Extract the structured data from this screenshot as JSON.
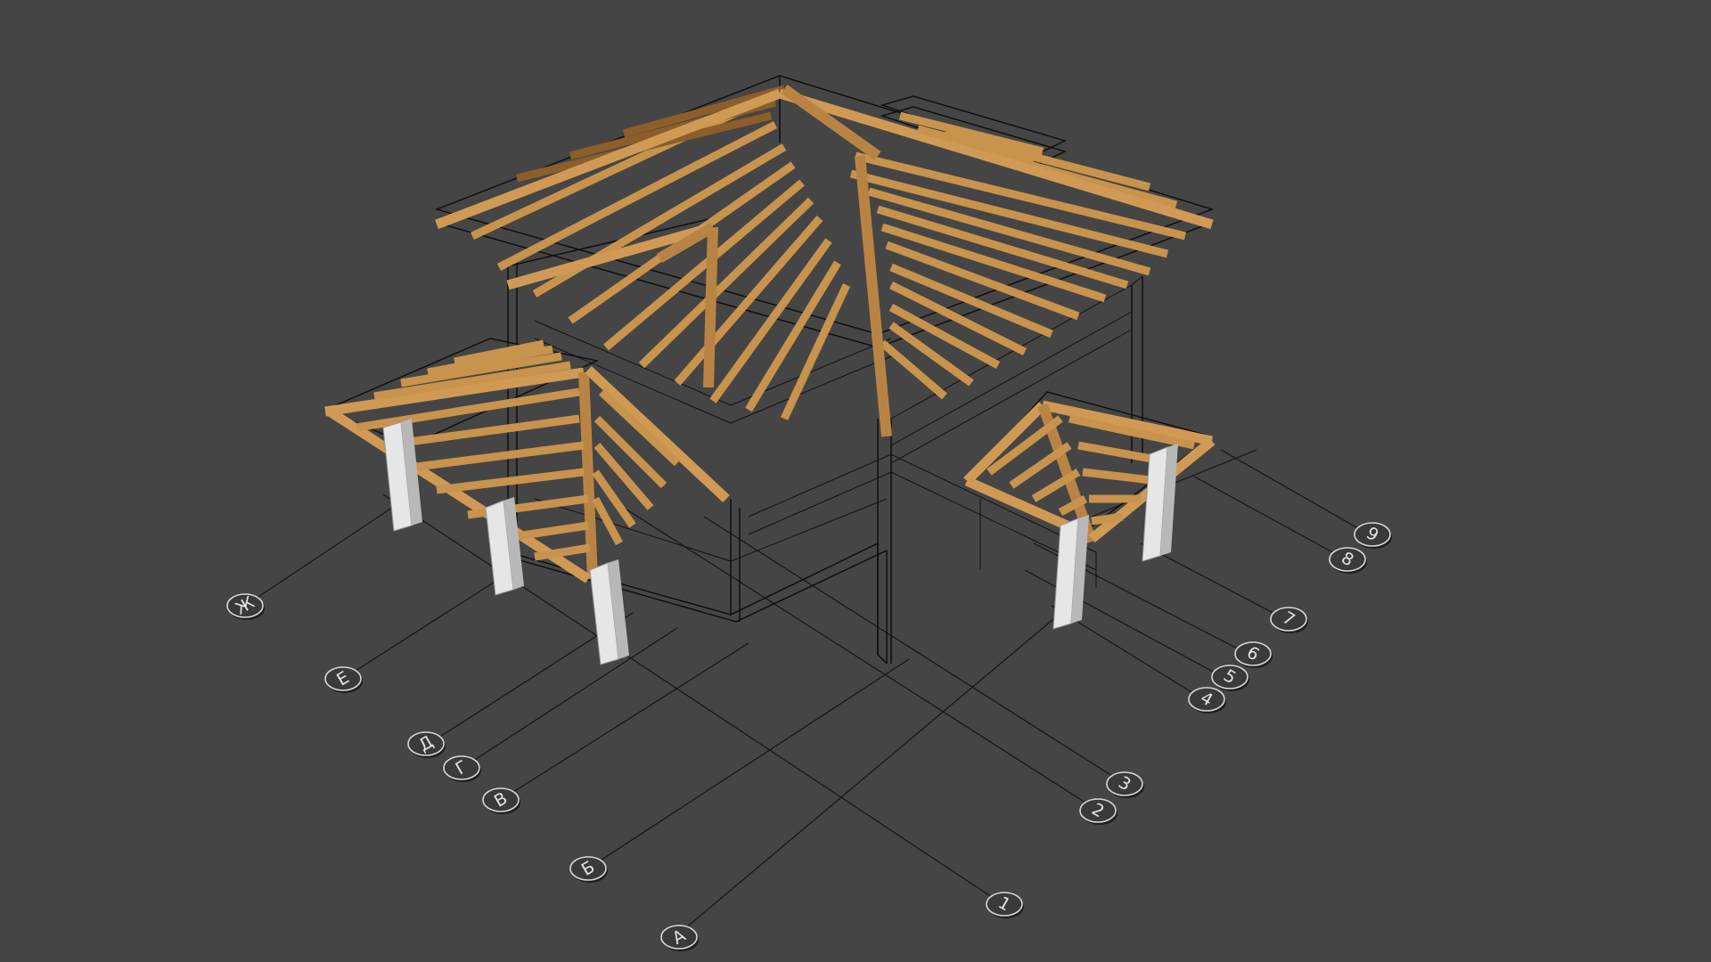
{
  "scene": {
    "background": "#454545",
    "wood_color": "#c8934d",
    "column_color": "#e6e6e6",
    "wire_color": "#0c0c0c"
  },
  "grid_axes": {
    "letters": [
      "Ж",
      "Е",
      "Д",
      "Г",
      "В",
      "Б",
      "А"
    ],
    "numbers": [
      "1",
      "2",
      "3",
      "4",
      "5",
      "6",
      "7",
      "8",
      "9"
    ]
  }
}
